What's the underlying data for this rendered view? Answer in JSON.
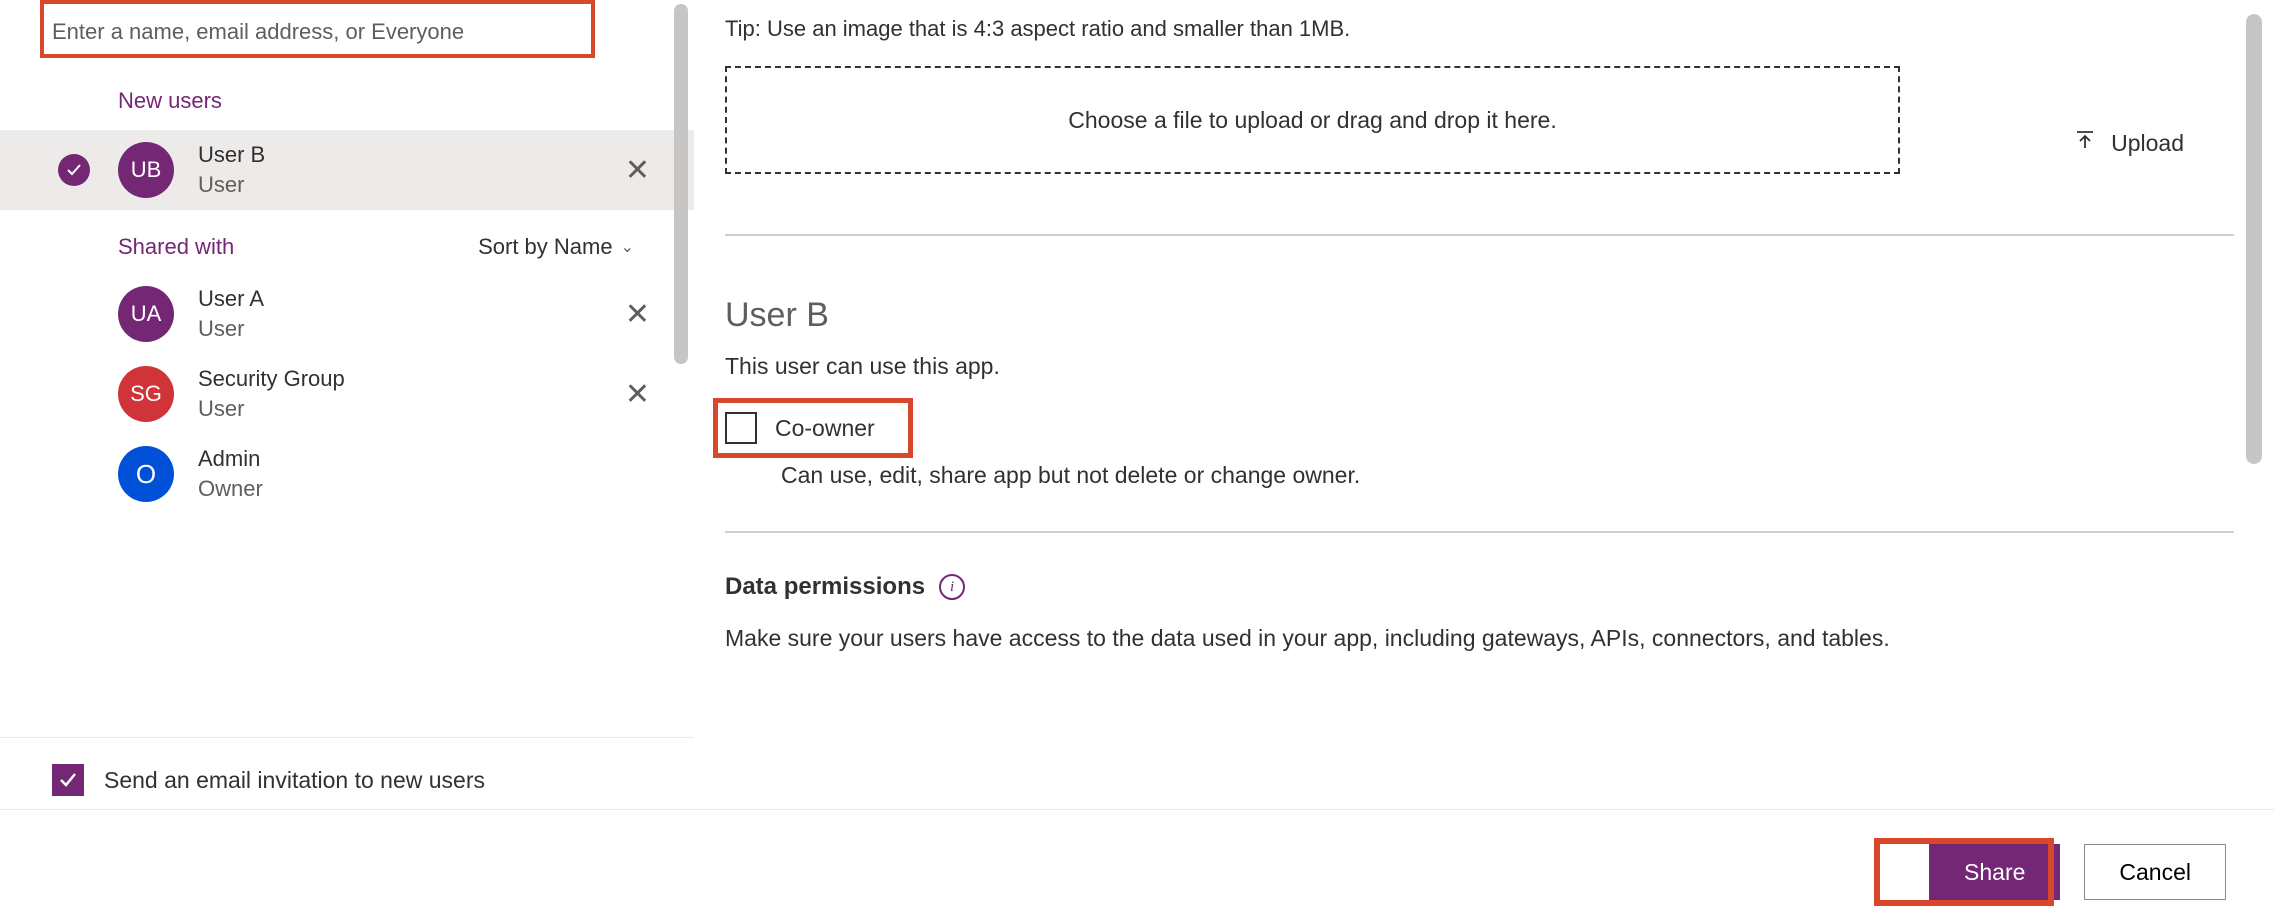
{
  "search": {
    "placeholder": "Enter a name, email address, or Everyone"
  },
  "sections": {
    "new_users": "New users",
    "shared_with": "Shared with",
    "sort_by": "Sort by Name"
  },
  "selected_user": {
    "initials": "UB",
    "name": "User B",
    "role": "User"
  },
  "shared_users": [
    {
      "initials": "UA",
      "name": "User A",
      "role": "User",
      "color": "purple"
    },
    {
      "initials": "SG",
      "name": "Security Group",
      "role": "User",
      "color": "red"
    },
    {
      "initials": "O",
      "name": "Admin",
      "role": "Owner",
      "color": "blue"
    }
  ],
  "email_invite": {
    "label": "Send an email invitation to new users",
    "checked": true
  },
  "image_tip": "Tip: Use an image that is 4:3 aspect ratio and smaller than 1MB.",
  "dropzone": "Choose a file to upload or drag and drop it here.",
  "upload_label": "Upload",
  "detail": {
    "title": "User B",
    "subtitle": "This user can use this app.",
    "coowner_label": "Co-owner",
    "coowner_desc": "Can use, edit, share app but not delete or change owner."
  },
  "data_permissions": {
    "title": "Data permissions",
    "desc": "Make sure your users have access to the data used in your app, including gateways, APIs, connectors, and tables."
  },
  "buttons": {
    "share": "Share",
    "cancel": "Cancel"
  }
}
